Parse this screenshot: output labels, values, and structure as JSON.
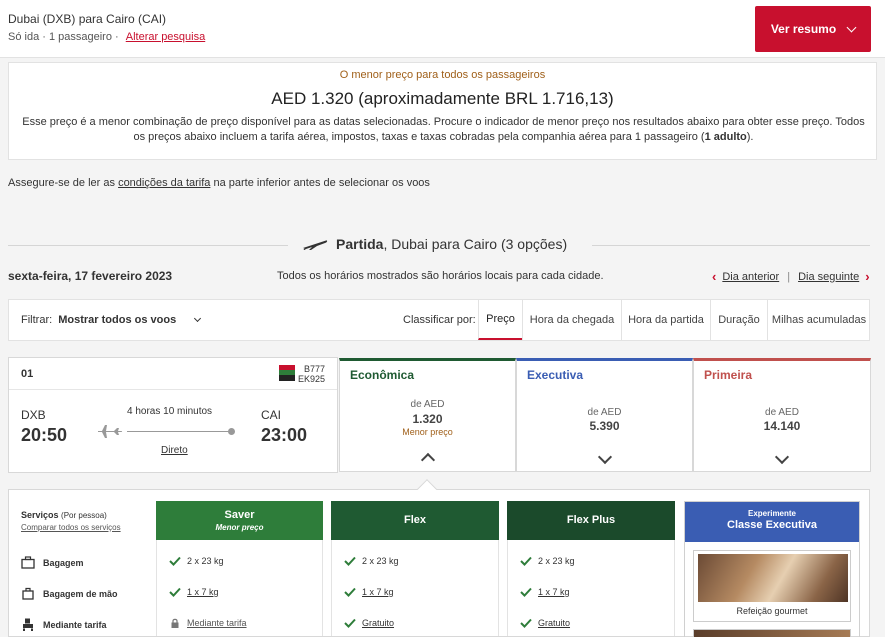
{
  "header": {
    "route": "Dubai (DXB) para Cairo (CAI)",
    "trip_info": "Só ida · 1 passageiro ·",
    "change_search": "Alterar pesquisa",
    "summary_button": "Ver resumo"
  },
  "lowest_price": {
    "label": "O menor preço para todos os passageiros",
    "amount": "AED 1.320 (aproximadamente BRL 1.716,13)",
    "description_pre": "Esse preço é a menor combinação de preço disponível para as datas selecionadas. Procure o indicador de menor preço nos resultados abaixo para obter esse preço. Todos os preços abaixo incluem a tarifa aérea, impostos, taxas e taxas cobradas pela companhia aérea para 1 passageiro (",
    "description_bold": "1 adulto",
    "description_post": ")."
  },
  "notice": {
    "pre": "Assegure-se de ler as ",
    "link": "condições da tarifa",
    "post": " na parte inferior antes de selecionar os voos"
  },
  "section": {
    "title_bold": "Partida",
    "title_rest": ", Dubai para Cairo (3 opções)"
  },
  "date_bar": {
    "date": "sexta-feira, 17 fevereiro 2023",
    "local_time_note": "Todos os horários mostrados são horários locais para cada cidade.",
    "prev_day": "Dia anterior",
    "separator": "|",
    "next_day": "Dia seguinte"
  },
  "filter_bar": {
    "filter_label": "Filtrar:",
    "filter_value": "Mostrar todos os voos",
    "sort_label": "Classificar por:",
    "sort_tabs": [
      "Preço",
      "Hora da chegada",
      "Hora da partida",
      "Duração",
      "Milhas acumuladas"
    ],
    "active_sort": "Preço"
  },
  "flight": {
    "number": "01",
    "aircraft": "B777",
    "flight_code": "EK925",
    "origin": "DXB",
    "departure": "20:50",
    "destination": "CAI",
    "arrival": "23:00",
    "duration": "4 horas 10 minutos",
    "stops": "Direto"
  },
  "cabins": [
    {
      "name": "Econômica",
      "from": "de AED",
      "price": "1.320",
      "badge": "Menor preço",
      "color": "#1f5a32",
      "expanded": true
    },
    {
      "name": "Executiva",
      "from": "de AED",
      "price": "5.390",
      "color": "#3a5db3",
      "expanded": false
    },
    {
      "name": "Primeira",
      "from": "de AED",
      "price": "14.140",
      "color": "#c0504d",
      "expanded": false
    }
  ],
  "services": {
    "title": "Serviços",
    "per_person": "(Por pessoa)",
    "compare": "Comparar todos os serviços",
    "rows": [
      {
        "label": "Bagagem",
        "icon": "suitcase-icon"
      },
      {
        "label": "Bagagem de mão",
        "icon": "carry-on-bag-icon"
      },
      {
        "label": "Mediante tarifa",
        "icon": "seat-icon"
      }
    ]
  },
  "fares": [
    {
      "name": "Saver",
      "subtitle": "Menor preço",
      "color": "#2e7d3a",
      "baggage": "2 x 23 kg",
      "carry_on": "1 x 7 kg",
      "seat": "Mediante tarifa",
      "seat_locked": true
    },
    {
      "name": "Flex",
      "color": "#1f5a32",
      "baggage": "2 x 23 kg",
      "carry_on": "1 x 7 kg",
      "seat": "Gratuito",
      "seat_locked": false
    },
    {
      "name": "Flex Plus",
      "color": "#1b4a2b",
      "baggage": "2 x 23 kg",
      "carry_on": "1 x 7 kg",
      "seat": "Gratuito",
      "seat_locked": false
    }
  ],
  "business_upsell": {
    "pre": "Experimente",
    "title": "Classe Executiva",
    "caption": "Refeição gourmet",
    "color": "#3a5db3"
  },
  "colors": {
    "brand_red": "#c8102e",
    "check_green": "#2e7d3a",
    "highlight_orange": "#a0601a"
  }
}
